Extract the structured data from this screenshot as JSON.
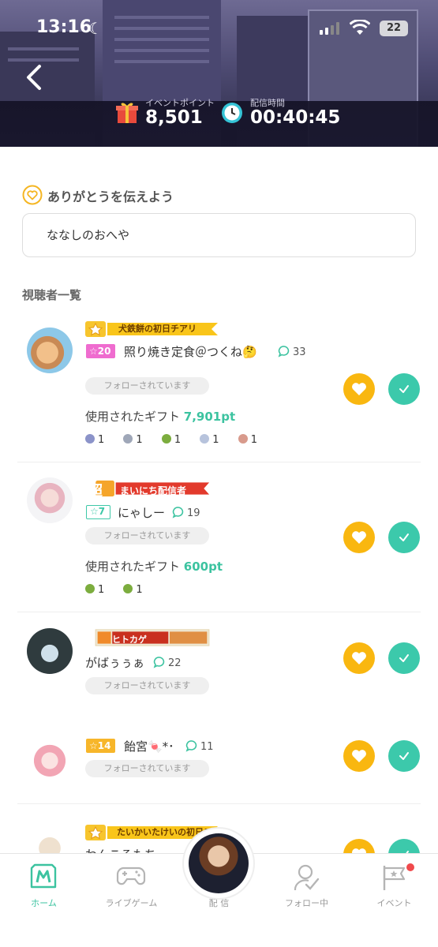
{
  "status_bar": {
    "time": "13:16",
    "battery": "22"
  },
  "stats": {
    "points_label": "イベントポイント",
    "points_value": "8,501",
    "time_label": "配信時間",
    "time_value": "00:40:45"
  },
  "thanks": {
    "title": "ありがとうを伝えよう",
    "value": "ななしのおへや"
  },
  "viewers_title": "視聴者一覧",
  "viewers": [
    {
      "banner_text": "犬鉄餅の初日チアリ",
      "level": "☆20",
      "name": "照り焼き定食＠つくね🤔",
      "comments": "33",
      "follow": "フォローされています",
      "gift_label": "使用されたギフト",
      "gift_points": "7,901pt",
      "gifts": [
        "1",
        "1",
        "1",
        "1",
        "1"
      ]
    },
    {
      "banner_text": "まいにち配信者",
      "banner_badge": "超",
      "level": "☆7",
      "name": "にゃしー",
      "comments": "19",
      "follow": "フォローされています",
      "gift_label": "使用されたギフト",
      "gift_points": "600pt",
      "gifts": [
        "1",
        "1"
      ]
    },
    {
      "banner_text": "ヒトカゲ",
      "name": "がばぅぅぁ",
      "comments": "22",
      "follow": "フォローされています"
    },
    {
      "level": "☆14",
      "name": "飴宮🍬*･",
      "comments": "11",
      "follow": "フォローされています"
    },
    {
      "banner_text": "たいかいたけいの初日チアリ",
      "name": "わんころもち"
    }
  ],
  "tabs": [
    {
      "label": "ホーム",
      "icon": "home-m-icon"
    },
    {
      "label": "ライブゲーム",
      "icon": "gamepad-icon"
    },
    {
      "label": "配 信",
      "icon": "broadcast-avatar"
    },
    {
      "label": "フォロー中",
      "icon": "follow-check-icon"
    },
    {
      "label": "イベント",
      "icon": "event-flag-icon"
    }
  ],
  "colors": {
    "accent": "#3cc3a0",
    "heart": "#f9b710",
    "check": "#3cc9ab",
    "level_pink": "#ef6ccf"
  }
}
